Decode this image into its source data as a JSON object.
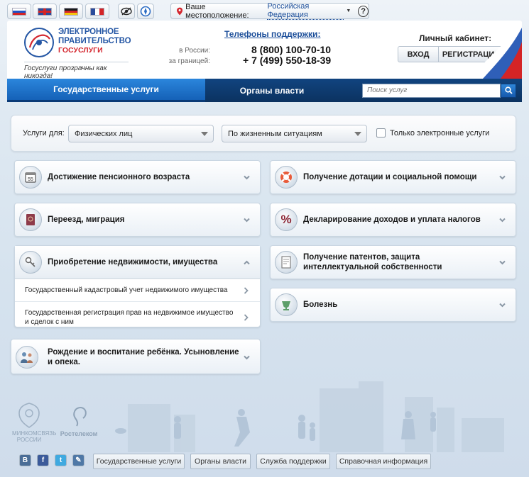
{
  "topbar": {
    "flags": [
      {
        "name": "flag-russian",
        "icon": "russian-flag-icon"
      },
      {
        "name": "flag-english",
        "icon": "uk-flag-icon"
      },
      {
        "name": "flag-german",
        "icon": "german-flag-icon"
      },
      {
        "name": "flag-french",
        "icon": "french-flag-icon"
      }
    ],
    "location_label": "Ваше местоположение:",
    "location_value": "Российская Федерация",
    "help_label": "?"
  },
  "header": {
    "logo_line1": "ЭЛЕКТРОННОЕ",
    "logo_line2": "ПРАВИТЕЛЬСТВО",
    "logo_line3": "ГОСУСЛУГИ",
    "slogan": "Госуслуги прозрачны как никогда!",
    "phones_title": "Телефоны поддержки:",
    "phone_russia_label": "в России:",
    "phone_russia": "8 (800) 100-70-10",
    "phone_abroad_label": "за границей:",
    "phone_abroad": "+ 7 (499) 550-18-39",
    "cabinet_title": "Личный кабинет:",
    "login_label": "ВХОД",
    "register_label": "РЕГИСТРАЦИЯ"
  },
  "nav": {
    "tab_services": "Государственные услуги",
    "tab_authorities": "Органы власти",
    "search_placeholder": "Поиск услуг"
  },
  "filter": {
    "label": "Услуги для:",
    "audience_value": "Физических лиц",
    "category_value": "По жизненным ситуациям",
    "electronic_only_label": "Только электронные услуги",
    "electronic_only_checked": false
  },
  "categories": {
    "pension": {
      "title": "Достижение пенсионного возраста",
      "icon": "calendar-55-icon"
    },
    "subsidy": {
      "title": "Получение дотации и социальной помощи",
      "icon": "lifebuoy-icon"
    },
    "migration": {
      "title": "Переезд, миграция",
      "icon": "passport-icon"
    },
    "taxes": {
      "title": "Декларирование доходов и уплата налогов",
      "icon": "percent-icon"
    },
    "property": {
      "title": "Приобретение недвижимости, имущества",
      "icon": "keys-icon",
      "expanded": true,
      "items": [
        "Государственный кадастровый учет недвижимого имущества",
        "Государственная регистрация прав на недвижимое имущество и сделок с ним"
      ]
    },
    "patents": {
      "title": "Получение патентов, защита интеллектуальной собственности",
      "icon": "certificate-icon"
    },
    "illness": {
      "title": "Болезнь",
      "icon": "medicine-icon"
    },
    "child": {
      "title": "Рождение и воспитание ребёнка. Усыновление и опека.",
      "icon": "family-icon"
    }
  },
  "footer": {
    "minsvyaz_text": "МИНКОМСВЯЗЬ РОССИИ",
    "rostelecom_text": "Ростелеком",
    "social": [
      {
        "name": "vkontakte",
        "label": "B",
        "icon": "vkontakte-icon",
        "color": "#4a6d96"
      },
      {
        "name": "facebook",
        "label": "f",
        "icon": "facebook-icon",
        "color": "#3b5a9a"
      },
      {
        "name": "twitter",
        "label": "t",
        "icon": "twitter-icon",
        "color": "#3fa9e0"
      },
      {
        "name": "livejournal",
        "label": "✎",
        "icon": "livejournal-icon",
        "color": "#4f78a6"
      }
    ],
    "links": {
      "services": "Государственные услуги",
      "authorities": "Органы власти",
      "support": "Служба поддержки",
      "reference": "Справочная информация"
    }
  },
  "colors": {
    "brand_blue": "#2456a4",
    "brand_red": "#d4272f",
    "nav_blue": "#1561b7",
    "nav_dark": "#0b3260"
  }
}
